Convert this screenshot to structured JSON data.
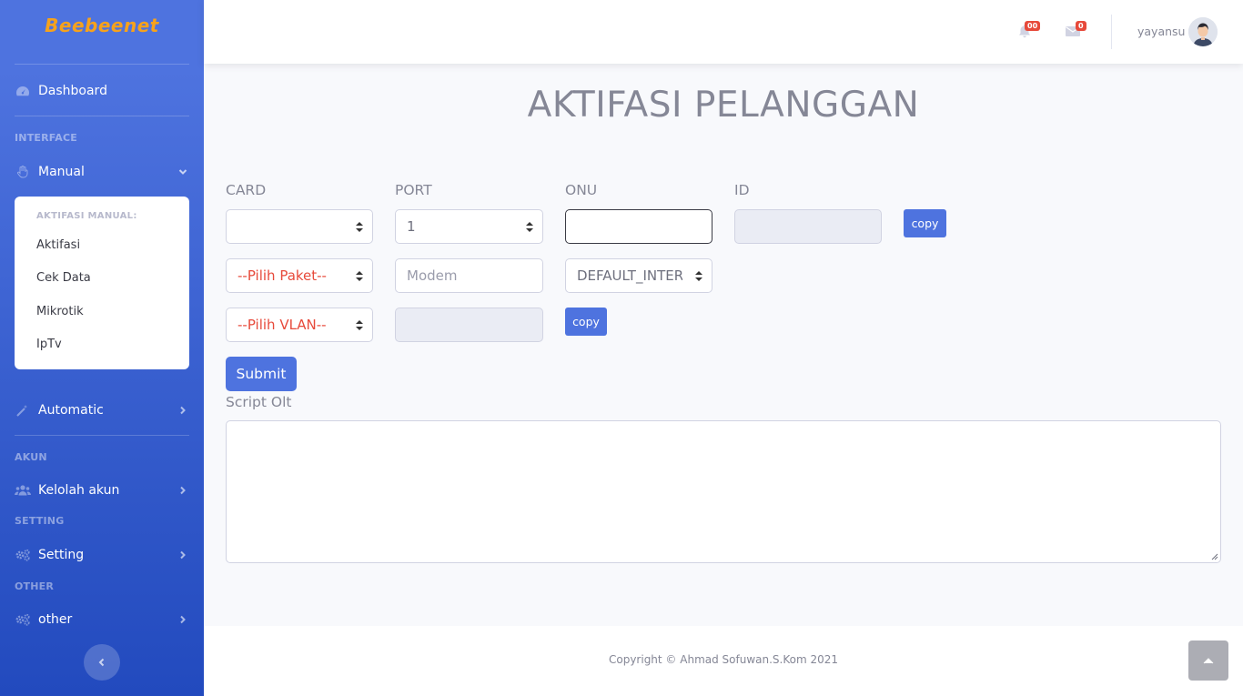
{
  "brand": "Beebeenet",
  "sidebar": {
    "dashboard": "Dashboard",
    "heading_interface": "INTERFACE",
    "manual": "Manual",
    "submenu_heading": "AKTIFASI MANUAL:",
    "submenu_items": [
      "Aktifasi",
      "Cek Data",
      "Mikrotik",
      "IpTv"
    ],
    "automatic": "Automatic",
    "heading_akun": "AKUN",
    "kelolah_akun": "Kelolah akun",
    "heading_setting": "SETTING",
    "setting": "Setting",
    "heading_other": "OTHER",
    "other": "other"
  },
  "topbar": {
    "alerts_badge": "00",
    "messages_badge": "0",
    "username": "yayansu"
  },
  "main": {
    "title": "AKTIFASI PELANGGAN",
    "labels": {
      "card": "CARD",
      "port": "PORT",
      "onu": "ONU",
      "id": "ID"
    },
    "card_value": "",
    "port_value": "1",
    "onu_value": "",
    "id_value": "",
    "copy_label": "copy",
    "paket_value": "--Pilih Paket--",
    "modem_placeholder": "Modem",
    "profile_value": "DEFAULT_INTERNET",
    "vlan_value": "--Pilih VLAN--",
    "vlan_field_value": "",
    "submit_label": "Submit",
    "script_label": "Script Olt",
    "script_value": ""
  },
  "footer": {
    "copyright": "Copyright © Ahmad Sofuwan.S.Kom 2021"
  },
  "colors": {
    "primary": "#4e73df",
    "brand_orange": "#f6a21c",
    "danger": "#e74a3b"
  }
}
